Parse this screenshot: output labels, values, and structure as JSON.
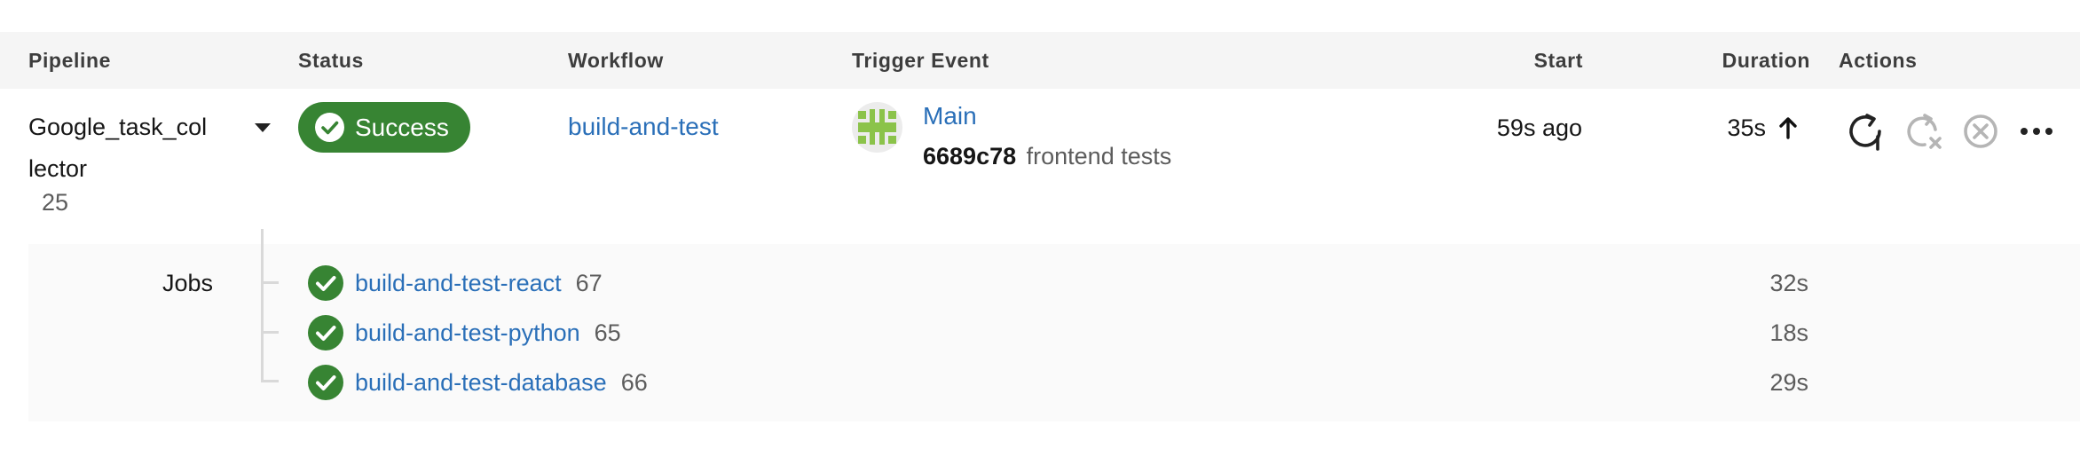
{
  "headers": {
    "pipeline": "Pipeline",
    "status": "Status",
    "workflow": "Workflow",
    "trigger": "Trigger Event",
    "start": "Start",
    "duration": "Duration",
    "actions": "Actions"
  },
  "pipeline": {
    "name_line1": "Google_task_col",
    "name_line2": "lector",
    "number": "25",
    "status": "Success",
    "workflow": "build-and-test",
    "trigger_branch": "Main",
    "commit_hash": "6689c78",
    "commit_message": "frontend tests",
    "start": "59s ago",
    "duration": "35s"
  },
  "jobs": {
    "label": "Jobs",
    "items": [
      {
        "name": "build-and-test-react",
        "number": "67",
        "duration": "32s"
      },
      {
        "name": "build-and-test-python",
        "number": "65",
        "duration": "18s"
      },
      {
        "name": "build-and-test-database",
        "number": "66",
        "duration": "29s"
      }
    ]
  },
  "colors": {
    "success": "#378433",
    "link": "#2a6fb8",
    "header_bg": "#f5f5f5",
    "jobs_bg": "#fafafa",
    "avatar": "#8bc34a"
  },
  "icons": {
    "dropdown": "caret-down-icon",
    "status": "check-circle-icon",
    "trigger": "avatar-icon",
    "duration_trend": "arrow-up-icon",
    "rerun": "rerun-icon",
    "rerun_failed": "rerun-failed-icon",
    "cancel": "cancel-icon",
    "more": "more-icon"
  }
}
